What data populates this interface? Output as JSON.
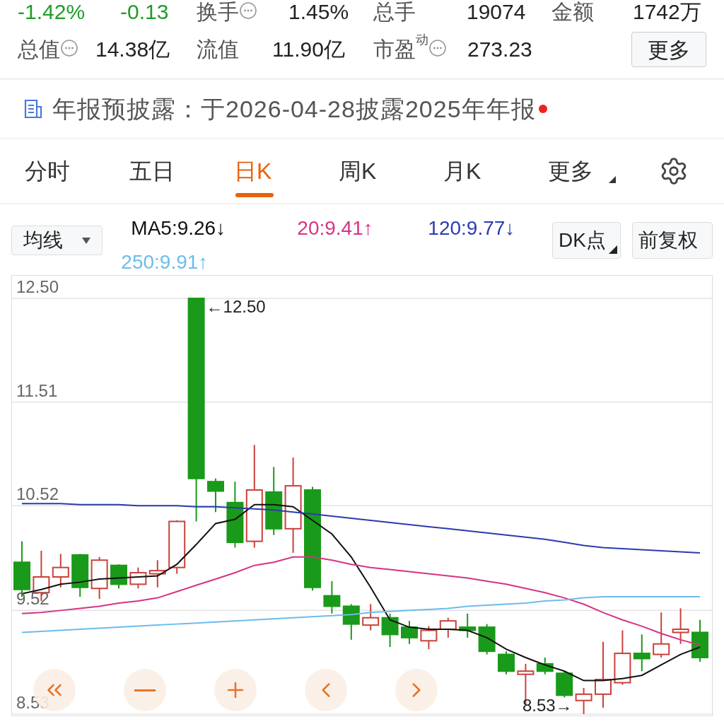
{
  "quote": {
    "change_pct": "-1.42%",
    "change": "-0.13",
    "row1": [
      {
        "label": "换手",
        "info": true,
        "value": "1.45%"
      },
      {
        "label": "总手",
        "info": false,
        "value": "19074"
      },
      {
        "label": "金额",
        "info": false,
        "value": "1742万"
      }
    ],
    "row2": [
      {
        "label": "总值",
        "info": true,
        "value": "14.38亿"
      },
      {
        "label": "流值",
        "info": false,
        "value": "11.90亿"
      },
      {
        "label": "市盈",
        "sup": "动",
        "info": true,
        "value": "273.23"
      }
    ],
    "more_button": "更多"
  },
  "notice": {
    "text": "年报预披露：于2026-04-28披露2025年年报",
    "unread": true
  },
  "tabs": [
    {
      "label": "分时",
      "selected": false,
      "dropdown": false
    },
    {
      "label": "五日",
      "selected": false,
      "dropdown": false
    },
    {
      "label": "日K",
      "selected": true,
      "dropdown": false
    },
    {
      "label": "周K",
      "selected": false,
      "dropdown": false
    },
    {
      "label": "月K",
      "selected": false,
      "dropdown": false
    },
    {
      "label": "更多",
      "selected": false,
      "dropdown": true
    }
  ],
  "indicator_select": "均线",
  "ma_readings": [
    {
      "text": "MA5:9.26↓",
      "color": "#111111"
    },
    {
      "text": "20:9.41↑",
      "color": "#d63384"
    },
    {
      "text": "120:9.77↓",
      "color": "#2a3bb0"
    },
    {
      "text": "250:9.91↑",
      "color": "#6cbcec"
    }
  ],
  "buttons": [
    {
      "label": "DK点",
      "dropdown": true
    },
    {
      "label": "前复权",
      "dropdown": false
    }
  ],
  "chart_data": {
    "type": "line",
    "grid": true,
    "ylim": [
      8.53,
      12.5
    ],
    "yticks": [
      {
        "value": 12.5,
        "label": "12.50"
      },
      {
        "value": 11.51,
        "label": "11.51"
      },
      {
        "value": 10.52,
        "label": "10.52"
      },
      {
        "value": 9.52,
        "label": "9.52"
      },
      {
        "value": 8.53,
        "label": "8.53"
      }
    ],
    "series": [
      {
        "color": "#111111",
        "values": [
          9.68,
          9.72,
          9.77,
          9.79,
          9.82,
          9.83,
          9.84,
          9.85,
          9.96,
          10.15,
          10.35,
          10.39,
          10.53,
          10.53,
          10.51,
          10.38,
          10.25,
          10.03,
          9.74,
          9.43,
          9.36,
          9.34,
          9.34,
          9.33,
          9.26,
          9.15,
          9.07,
          9.0,
          8.94,
          8.85,
          8.85,
          8.87,
          8.9,
          9.0,
          9.1,
          9.17
        ]
      },
      {
        "color": "#d63384",
        "values": [
          9.49,
          9.5,
          9.52,
          9.54,
          9.56,
          9.59,
          9.61,
          9.64,
          9.7,
          9.76,
          9.82,
          9.88,
          9.95,
          9.98,
          10.03,
          10.03,
          10.0,
          9.96,
          9.93,
          9.91,
          9.89,
          9.87,
          9.85,
          9.83,
          9.8,
          9.77,
          9.73,
          9.69,
          9.64,
          9.58,
          9.5,
          9.43,
          9.37,
          9.3,
          9.24,
          9.19
        ]
      },
      {
        "color": "#2a3bb0",
        "values": [
          10.54,
          10.54,
          10.54,
          10.53,
          10.53,
          10.53,
          10.52,
          10.52,
          10.52,
          10.51,
          10.51,
          10.5,
          10.49,
          10.48,
          10.46,
          10.44,
          10.42,
          10.4,
          10.38,
          10.36,
          10.34,
          10.32,
          10.3,
          10.28,
          10.26,
          10.24,
          10.22,
          10.2,
          10.17,
          10.14,
          10.12,
          10.11,
          10.1,
          10.09,
          10.08,
          10.07
        ]
      },
      {
        "color": "#6cbcec",
        "values": [
          9.31,
          9.32,
          9.33,
          9.34,
          9.35,
          9.36,
          9.37,
          9.38,
          9.39,
          9.4,
          9.41,
          9.42,
          9.43,
          9.44,
          9.45,
          9.46,
          9.47,
          9.48,
          9.5,
          9.51,
          9.52,
          9.53,
          9.54,
          9.56,
          9.57,
          9.58,
          9.59,
          9.61,
          9.62,
          9.64,
          9.65,
          9.65,
          9.65,
          9.65,
          9.65,
          9.65
        ]
      }
    ],
    "annotations": [
      {
        "text": "←12.50"
      },
      {
        "text": "8.53→"
      }
    ]
  },
  "chart_controls": [
    {
      "kind": "first"
    },
    {
      "kind": "zoom_out"
    },
    {
      "kind": "zoom_in"
    },
    {
      "kind": "prev"
    },
    {
      "kind": "next"
    }
  ]
}
